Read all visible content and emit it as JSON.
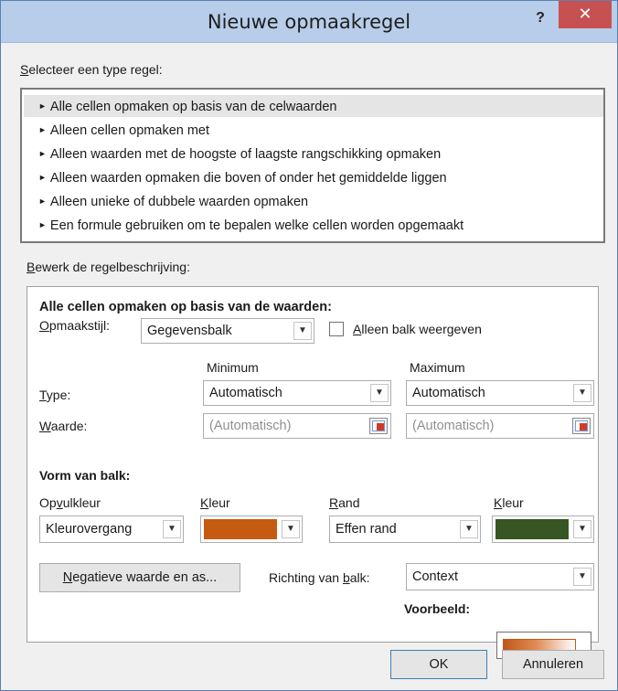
{
  "dialog": {
    "title": "Nieuwe opmaakregel",
    "help_label": "?",
    "close_label": "✕"
  },
  "rule_type": {
    "heading_key": "S",
    "heading_rest": "electeer een type regel:",
    "bullet": "►",
    "items": [
      {
        "label": "Alle cellen opmaken op basis van de celwaarden",
        "selected": true
      },
      {
        "label": "Alleen cellen opmaken met",
        "selected": false
      },
      {
        "label": "Alleen waarden met de hoogste of laagste rangschikking opmaken",
        "selected": false
      },
      {
        "label": "Alleen waarden opmaken die boven of onder het gemiddelde liggen",
        "selected": false
      },
      {
        "label": "Alleen unieke of dubbele waarden opmaken",
        "selected": false
      },
      {
        "label": "Een formule gebruiken om te bepalen welke cellen worden opgemaakt",
        "selected": false
      }
    ]
  },
  "description": {
    "heading_key": "B",
    "heading_rest": "ewerk de regelbeschrijving:",
    "section_title": "Alle cellen opmaken op basis van de waarden:",
    "format_style": {
      "label_key": "O",
      "label_rest": "pmaakstijl:",
      "value": "Gegevensbalk",
      "bar_only_key": "A",
      "bar_only_rest": "lleen balk weergeven",
      "bar_only_checked": false
    },
    "minimum_header": "Minimum",
    "maximum_header": "Maximum",
    "type": {
      "label_key": "T",
      "label_rest": "ype:",
      "min_value": "Automatisch",
      "max_value": "Automatisch"
    },
    "value": {
      "label_key": "W",
      "label_rest": "aarde:",
      "min_value": "(Automatisch)",
      "max_value": "(Automatisch)"
    },
    "bar_shape": {
      "title": "Vorm van balk:",
      "fill_label_pre": "Op",
      "fill_label_key": "v",
      "fill_label_post": "ulkleur",
      "fill_value": "Kleurovergang",
      "fill_color_label_key": "K",
      "fill_color_label_rest": "leur",
      "fill_color": "#c55a11",
      "border_label_key": "R",
      "border_label_rest": "and",
      "border_value": "Effen rand",
      "border_color_label_key": "K",
      "border_color_label_rest": "leur",
      "border_color": "#375623"
    },
    "negative_button_key": "N",
    "negative_button_rest": "egatieve waarde en as...",
    "direction": {
      "label_pre": "Richting van ",
      "label_key": "b",
      "label_post": "alk:",
      "value": "Context"
    },
    "preview_label": "Voorbeeld:"
  },
  "footer": {
    "ok_label": "OK",
    "cancel_label": "Annuleren"
  },
  "colors": {
    "titlebar": "#b7cde9",
    "close_button": "#c75050",
    "dialog_background": "#f0f0f0"
  }
}
